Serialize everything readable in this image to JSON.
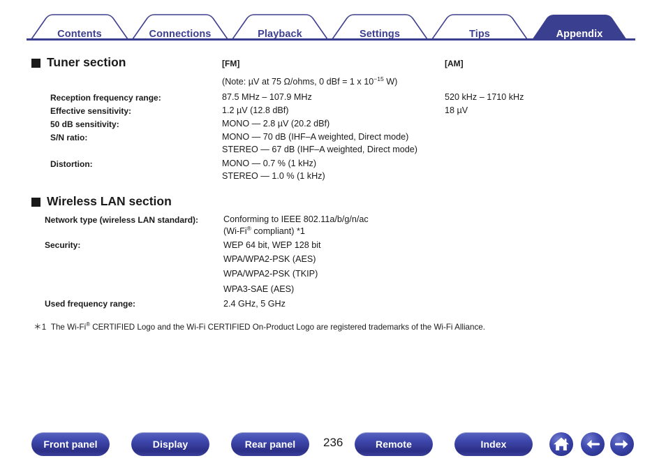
{
  "tabs": [
    {
      "label": "Contents",
      "active": false
    },
    {
      "label": "Connections",
      "active": false
    },
    {
      "label": "Playback",
      "active": false
    },
    {
      "label": "Settings",
      "active": false
    },
    {
      "label": "Tips",
      "active": false
    },
    {
      "label": "Appendix",
      "active": true
    }
  ],
  "colors": {
    "tab_accent": "#3d3f8f",
    "tab_active_fill": "#3b3f8f",
    "button_blue": "#2c2f86",
    "text": "#1a1a1a"
  },
  "sections": [
    {
      "title": "Tuner section",
      "columns": [
        {
          "header": "[FM]"
        },
        {
          "header": "[AM]"
        }
      ],
      "note": "(Note: µV at 75 Ω/ohms, 0 dBf = 1 x 10",
      "note_sup": "−15",
      "note_tail": " W)",
      "rows": [
        {
          "label": "Reception frequency range:",
          "fm": [
            "87.5 MHz – 107.9 MHz"
          ],
          "am": [
            "520 kHz – 1710 kHz"
          ]
        },
        {
          "label": "Effective sensitivity:",
          "fm": [
            "1.2 µV (12.8 dBf)"
          ],
          "am": [
            "18 µV"
          ]
        },
        {
          "label": "50 dB sensitivity:",
          "fm": [
            "MONO — 2.8 µV (20.2 dBf)"
          ],
          "am": []
        },
        {
          "label": "S/N ratio:",
          "fm": [
            "MONO — 70 dB (IHF–A weighted, Direct mode)",
            "STEREO — 67 dB (IHF–A weighted, Direct mode)"
          ],
          "am": []
        },
        {
          "label": "Distortion:",
          "fm": [
            "MONO — 0.7 % (1 kHz)",
            "STEREO — 1.0 % (1 kHz)"
          ],
          "am": []
        }
      ]
    },
    {
      "title": "Wireless LAN section",
      "rows": [
        {
          "label": "Network type (wireless LAN standard):",
          "value_line1": "Conforming to IEEE 802.11a/b/g/n/ac",
          "value_line2_pre": "(Wi-Fi",
          "value_line2_sup": "®",
          "value_line2_post": " compliant) *1"
        },
        {
          "label": "Security:",
          "values": [
            "WEP 64 bit, WEP 128 bit",
            "WPA/WPA2-PSK (AES)",
            "WPA/WPA2-PSK (TKIP)",
            "WPA3-SAE (AES)"
          ]
        },
        {
          "label": "Used frequency range:",
          "values": [
            "2.4 GHz, 5 GHz"
          ]
        }
      ]
    }
  ],
  "footnote": {
    "marker": "＊1",
    "pre": "The Wi-Fi",
    "sup": "®",
    "post": " CERTIFIED Logo and the Wi-Fi CERTIFIED On-Product Logo are registered trademarks of the Wi-Fi Alliance."
  },
  "bottom_bar": {
    "buttons": [
      {
        "label": "Front panel"
      },
      {
        "label": "Display"
      },
      {
        "label": "Rear panel"
      },
      {
        "label": "Remote"
      },
      {
        "label": "Index"
      }
    ],
    "page_number": "236",
    "icons": [
      {
        "name": "home-icon"
      },
      {
        "name": "arrow-left-icon"
      },
      {
        "name": "arrow-right-icon"
      }
    ]
  }
}
